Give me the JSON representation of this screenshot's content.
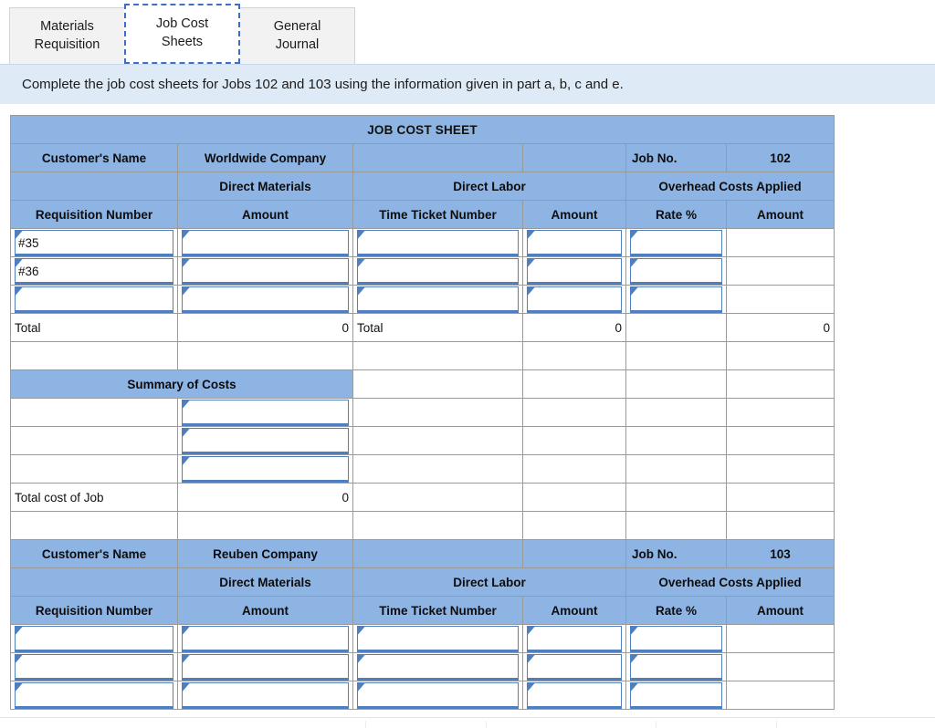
{
  "tabs": [
    {
      "label": "Materials\nRequisition",
      "name": "tab-materials-requisition",
      "active": false
    },
    {
      "label": "Job Cost\nSheets",
      "name": "tab-job-cost-sheets",
      "active": true
    },
    {
      "label": "General\nJournal",
      "name": "tab-general-journal",
      "active": false
    }
  ],
  "tab_labels": {
    "materials_requisition_line1": "Materials",
    "materials_requisition_line2": "Requisition",
    "job_cost_sheets_line1": "Job Cost",
    "job_cost_sheets_line2": "Sheets",
    "general_journal_line1": "General",
    "general_journal_line2": "Journal"
  },
  "instruction": {
    "text": "Complete the job cost sheets for Jobs 102 and 103 using the information given in part a, b, c and e."
  },
  "sheet": {
    "title": "JOB COST SHEET",
    "headers": {
      "customers_name": "Customer's Name",
      "job_no": "Job No.",
      "direct_materials": "Direct Materials",
      "direct_labor": "Direct Labor",
      "overhead_costs_applied": "Overhead Costs Applied",
      "requisition_number": "Requisition Number",
      "amount": "Amount",
      "time_ticket_number": "Time Ticket Number",
      "rate_pct": "Rate %",
      "total": "Total",
      "summary_of_costs": "Summary of Costs",
      "total_cost_of_job": "Total cost of Job"
    },
    "job102": {
      "customer": "Worldwide Company",
      "job_no": "102",
      "rows": [
        {
          "requisition": "#35",
          "materials_amount": "",
          "time_ticket": "",
          "labor_amount": "",
          "rate": "",
          "oh_amount": ""
        },
        {
          "requisition": "#36",
          "materials_amount": "",
          "time_ticket": "",
          "labor_amount": "",
          "rate": "",
          "oh_amount": ""
        },
        {
          "requisition": "",
          "materials_amount": "",
          "time_ticket": "",
          "labor_amount": "",
          "rate": "",
          "oh_amount": ""
        }
      ],
      "totals": {
        "materials_total": "0",
        "labor_total": "0",
        "overhead_total": "0"
      },
      "summary_rows": [
        {
          "label": "",
          "value": ""
        },
        {
          "label": "",
          "value": ""
        },
        {
          "label": "",
          "value": ""
        }
      ],
      "total_cost_of_job_value": "0"
    },
    "job103": {
      "customer": "Reuben Company",
      "job_no": "103",
      "rows": [
        {
          "requisition": "",
          "materials_amount": "",
          "time_ticket": "",
          "labor_amount": "",
          "rate": "",
          "oh_amount": ""
        },
        {
          "requisition": "",
          "materials_amount": "",
          "time_ticket": "",
          "labor_amount": "",
          "rate": "",
          "oh_amount": ""
        },
        {
          "requisition": "",
          "materials_amount": "",
          "time_ticket": "",
          "labor_amount": "",
          "rate": "",
          "oh_amount": ""
        }
      ]
    }
  },
  "colors": {
    "header_blue": "#8EB4E3",
    "banner_blue": "#DEEAF6",
    "input_border": "#4F7FBF",
    "grid_line": "#9A9A9A",
    "tab_inactive": "#F2F2F2",
    "focus_outline": "#3F6FC4"
  }
}
